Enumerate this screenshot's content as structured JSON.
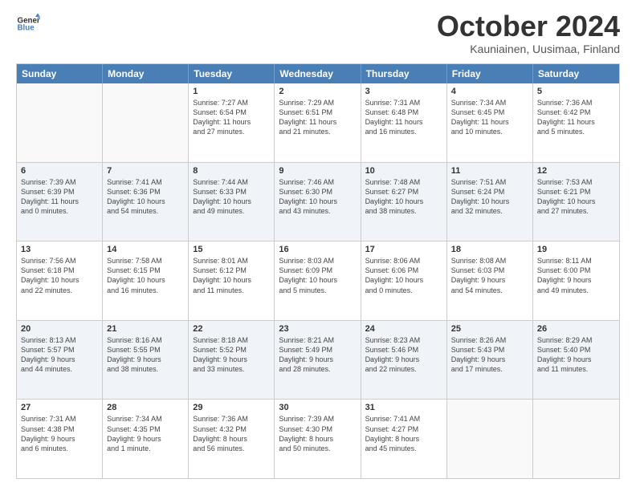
{
  "header": {
    "logo_line1": "General",
    "logo_line2": "Blue",
    "month": "October 2024",
    "location": "Kauniainen, Uusimaa, Finland"
  },
  "days_of_week": [
    "Sunday",
    "Monday",
    "Tuesday",
    "Wednesday",
    "Thursday",
    "Friday",
    "Saturday"
  ],
  "weeks": [
    [
      {
        "day": "",
        "lines": []
      },
      {
        "day": "",
        "lines": []
      },
      {
        "day": "1",
        "lines": [
          "Sunrise: 7:27 AM",
          "Sunset: 6:54 PM",
          "Daylight: 11 hours",
          "and 27 minutes."
        ]
      },
      {
        "day": "2",
        "lines": [
          "Sunrise: 7:29 AM",
          "Sunset: 6:51 PM",
          "Daylight: 11 hours",
          "and 21 minutes."
        ]
      },
      {
        "day": "3",
        "lines": [
          "Sunrise: 7:31 AM",
          "Sunset: 6:48 PM",
          "Daylight: 11 hours",
          "and 16 minutes."
        ]
      },
      {
        "day": "4",
        "lines": [
          "Sunrise: 7:34 AM",
          "Sunset: 6:45 PM",
          "Daylight: 11 hours",
          "and 10 minutes."
        ]
      },
      {
        "day": "5",
        "lines": [
          "Sunrise: 7:36 AM",
          "Sunset: 6:42 PM",
          "Daylight: 11 hours",
          "and 5 minutes."
        ]
      }
    ],
    [
      {
        "day": "6",
        "lines": [
          "Sunrise: 7:39 AM",
          "Sunset: 6:39 PM",
          "Daylight: 11 hours",
          "and 0 minutes."
        ]
      },
      {
        "day": "7",
        "lines": [
          "Sunrise: 7:41 AM",
          "Sunset: 6:36 PM",
          "Daylight: 10 hours",
          "and 54 minutes."
        ]
      },
      {
        "day": "8",
        "lines": [
          "Sunrise: 7:44 AM",
          "Sunset: 6:33 PM",
          "Daylight: 10 hours",
          "and 49 minutes."
        ]
      },
      {
        "day": "9",
        "lines": [
          "Sunrise: 7:46 AM",
          "Sunset: 6:30 PM",
          "Daylight: 10 hours",
          "and 43 minutes."
        ]
      },
      {
        "day": "10",
        "lines": [
          "Sunrise: 7:48 AM",
          "Sunset: 6:27 PM",
          "Daylight: 10 hours",
          "and 38 minutes."
        ]
      },
      {
        "day": "11",
        "lines": [
          "Sunrise: 7:51 AM",
          "Sunset: 6:24 PM",
          "Daylight: 10 hours",
          "and 32 minutes."
        ]
      },
      {
        "day": "12",
        "lines": [
          "Sunrise: 7:53 AM",
          "Sunset: 6:21 PM",
          "Daylight: 10 hours",
          "and 27 minutes."
        ]
      }
    ],
    [
      {
        "day": "13",
        "lines": [
          "Sunrise: 7:56 AM",
          "Sunset: 6:18 PM",
          "Daylight: 10 hours",
          "and 22 minutes."
        ]
      },
      {
        "day": "14",
        "lines": [
          "Sunrise: 7:58 AM",
          "Sunset: 6:15 PM",
          "Daylight: 10 hours",
          "and 16 minutes."
        ]
      },
      {
        "day": "15",
        "lines": [
          "Sunrise: 8:01 AM",
          "Sunset: 6:12 PM",
          "Daylight: 10 hours",
          "and 11 minutes."
        ]
      },
      {
        "day": "16",
        "lines": [
          "Sunrise: 8:03 AM",
          "Sunset: 6:09 PM",
          "Daylight: 10 hours",
          "and 5 minutes."
        ]
      },
      {
        "day": "17",
        "lines": [
          "Sunrise: 8:06 AM",
          "Sunset: 6:06 PM",
          "Daylight: 10 hours",
          "and 0 minutes."
        ]
      },
      {
        "day": "18",
        "lines": [
          "Sunrise: 8:08 AM",
          "Sunset: 6:03 PM",
          "Daylight: 9 hours",
          "and 54 minutes."
        ]
      },
      {
        "day": "19",
        "lines": [
          "Sunrise: 8:11 AM",
          "Sunset: 6:00 PM",
          "Daylight: 9 hours",
          "and 49 minutes."
        ]
      }
    ],
    [
      {
        "day": "20",
        "lines": [
          "Sunrise: 8:13 AM",
          "Sunset: 5:57 PM",
          "Daylight: 9 hours",
          "and 44 minutes."
        ]
      },
      {
        "day": "21",
        "lines": [
          "Sunrise: 8:16 AM",
          "Sunset: 5:55 PM",
          "Daylight: 9 hours",
          "and 38 minutes."
        ]
      },
      {
        "day": "22",
        "lines": [
          "Sunrise: 8:18 AM",
          "Sunset: 5:52 PM",
          "Daylight: 9 hours",
          "and 33 minutes."
        ]
      },
      {
        "day": "23",
        "lines": [
          "Sunrise: 8:21 AM",
          "Sunset: 5:49 PM",
          "Daylight: 9 hours",
          "and 28 minutes."
        ]
      },
      {
        "day": "24",
        "lines": [
          "Sunrise: 8:23 AM",
          "Sunset: 5:46 PM",
          "Daylight: 9 hours",
          "and 22 minutes."
        ]
      },
      {
        "day": "25",
        "lines": [
          "Sunrise: 8:26 AM",
          "Sunset: 5:43 PM",
          "Daylight: 9 hours",
          "and 17 minutes."
        ]
      },
      {
        "day": "26",
        "lines": [
          "Sunrise: 8:29 AM",
          "Sunset: 5:40 PM",
          "Daylight: 9 hours",
          "and 11 minutes."
        ]
      }
    ],
    [
      {
        "day": "27",
        "lines": [
          "Sunrise: 7:31 AM",
          "Sunset: 4:38 PM",
          "Daylight: 9 hours",
          "and 6 minutes."
        ]
      },
      {
        "day": "28",
        "lines": [
          "Sunrise: 7:34 AM",
          "Sunset: 4:35 PM",
          "Daylight: 9 hours",
          "and 1 minute."
        ]
      },
      {
        "day": "29",
        "lines": [
          "Sunrise: 7:36 AM",
          "Sunset: 4:32 PM",
          "Daylight: 8 hours",
          "and 56 minutes."
        ]
      },
      {
        "day": "30",
        "lines": [
          "Sunrise: 7:39 AM",
          "Sunset: 4:30 PM",
          "Daylight: 8 hours",
          "and 50 minutes."
        ]
      },
      {
        "day": "31",
        "lines": [
          "Sunrise: 7:41 AM",
          "Sunset: 4:27 PM",
          "Daylight: 8 hours",
          "and 45 minutes."
        ]
      },
      {
        "day": "",
        "lines": []
      },
      {
        "day": "",
        "lines": []
      }
    ]
  ]
}
